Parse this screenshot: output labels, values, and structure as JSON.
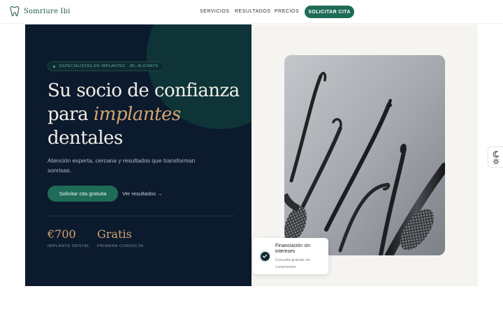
{
  "header": {
    "brand": "Somriure Ibi",
    "nav": [
      "SERVICIOS",
      "RESULTADOS",
      "PRECIOS"
    ],
    "cta": "SOLICITAR CITA"
  },
  "hero": {
    "badge": "ESPECIALISTAS EN IMPLANTES · IBI, ALICANTE",
    "title_line1": "Su socio de confianza",
    "title_line2_pre": "para ",
    "title_line2_accent": "implantes",
    "title_line3": "dentales",
    "subtitle": "Atención experta, cercana y resultados que transforman sonrisas.",
    "primary_button": "Solicitar cita gratuita",
    "secondary_link": "Ver resultados →",
    "stats": [
      {
        "value": "€700",
        "label": "IMPLANTE DENTAL"
      },
      {
        "value": "Gratis",
        "label": "PRIMERA CONSULTA"
      }
    ]
  },
  "card": {
    "title": "Financiación sin intereses",
    "subtitle": "Consulta gratuita sin compromiso"
  },
  "colors": {
    "brand_green": "#1e6b57",
    "navy": "#0c1a2e",
    "gold": "#d2a56f"
  },
  "icons": {
    "logo": "tooth-icon",
    "card": "check-circle-icon",
    "theme_dark": "moon-icon",
    "theme_light": "sun-icon"
  }
}
